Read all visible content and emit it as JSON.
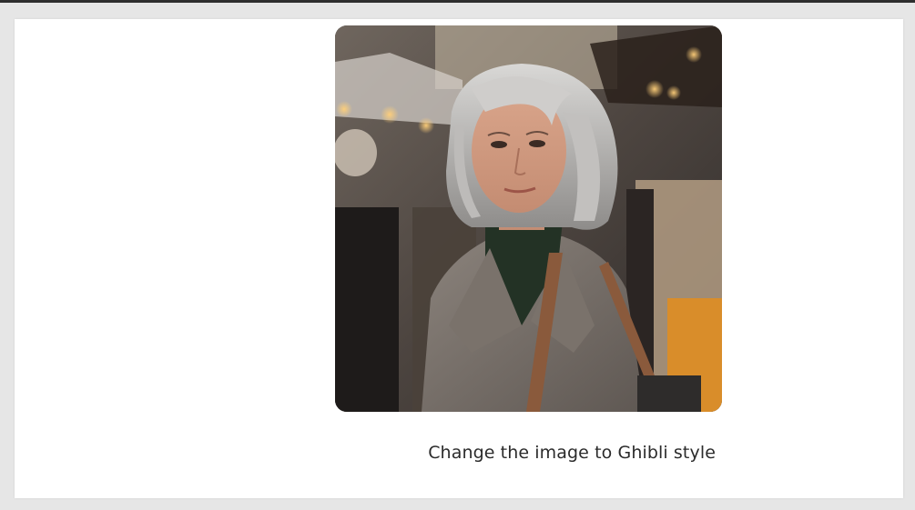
{
  "message": {
    "image": {
      "subject": "Photo of a woman with silver-grey bob hair in a grey wool coat, dark green turtleneck, brown leather shoulder bag, at a crowded outdoor market with warm bokeh lights"
    },
    "prompt_text": "Change the image to Ghibli style"
  },
  "colors": {
    "page_background": "#e6e6e6",
    "panel_background": "#ffffff",
    "text": "#2b2b2b"
  }
}
